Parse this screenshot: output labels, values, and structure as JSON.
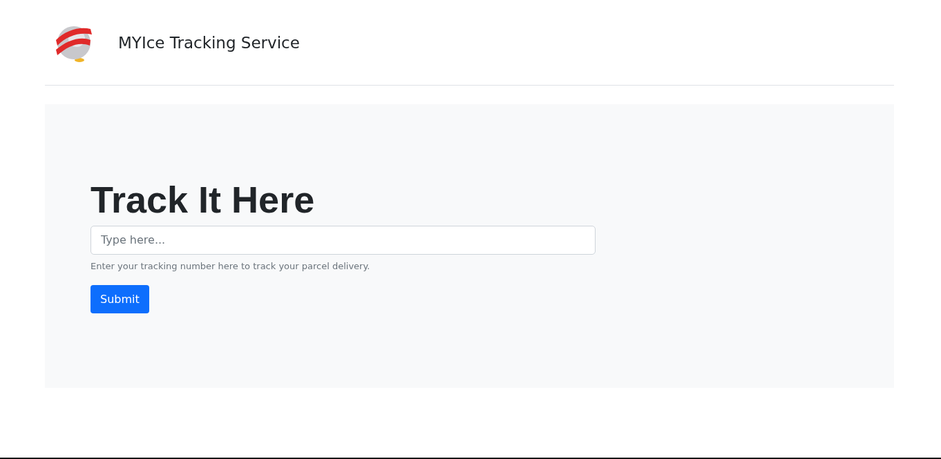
{
  "header": {
    "brand": "MYIce Tracking Service"
  },
  "hero": {
    "title": "Track It Here",
    "input": {
      "placeholder": "Type here..."
    },
    "help": "Enter your tracking number here to track your parcel delivery.",
    "button": "Submit"
  }
}
